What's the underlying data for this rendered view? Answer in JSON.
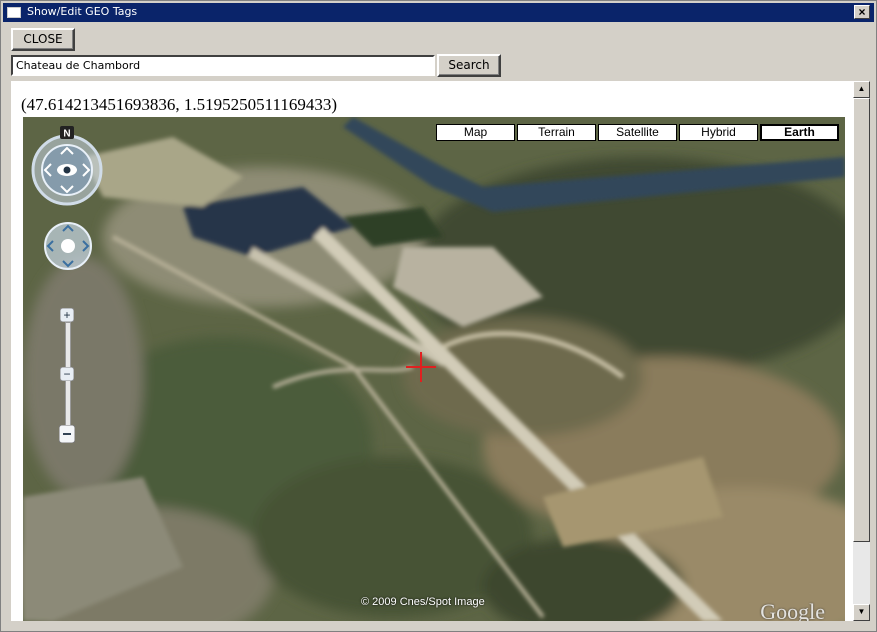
{
  "window": {
    "title": "Show/Edit GEO Tags",
    "close_glyph": "×"
  },
  "toolbar": {
    "close_label": "CLOSE",
    "search_value": "Chateau de Chambord",
    "search_label": "Search"
  },
  "location": {
    "coords_text": "(47.614213451693836, 1.5195250511169433)"
  },
  "map": {
    "types": [
      {
        "label": "Map",
        "active": false
      },
      {
        "label": "Terrain",
        "active": false
      },
      {
        "label": "Satellite",
        "active": false
      },
      {
        "label": "Hybrid",
        "active": false
      },
      {
        "label": "Earth",
        "active": true
      }
    ],
    "compass_north": "N",
    "zoom_plus": "+",
    "zoom_minus": "−",
    "copyright": "© 2009 Cnes/Spot Image",
    "logo": "Google"
  },
  "scrollbar": {
    "up_glyph": "▲",
    "down_glyph": "▼"
  }
}
